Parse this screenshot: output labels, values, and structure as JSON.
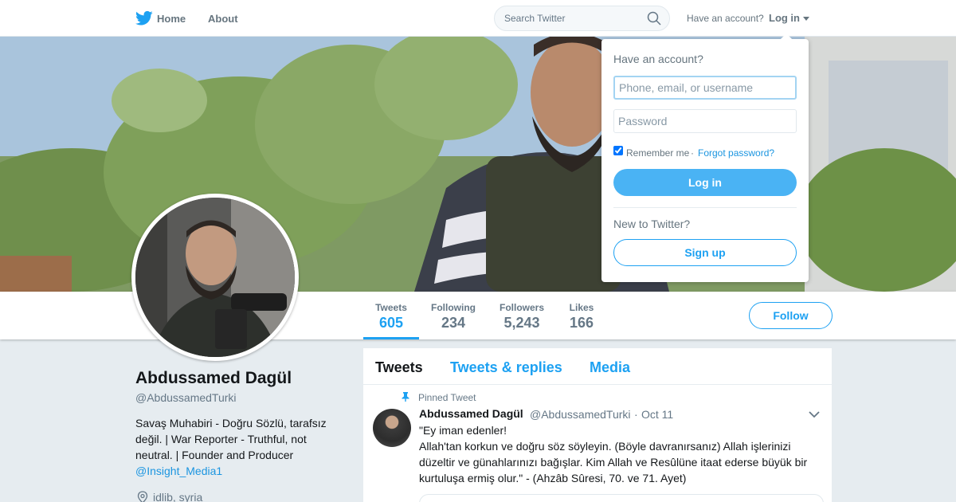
{
  "nav": {
    "home_label": "Home",
    "about_label": "About",
    "search_placeholder": "Search Twitter",
    "have_account_label": "Have an account?",
    "login_label": "Log in",
    "icons": [
      "twitter-bird-icon",
      "search-icon",
      "caret-down-icon"
    ]
  },
  "profile": {
    "name": "Abdussamed Dagül",
    "handle": "@AbdussamedTurki",
    "bio": "Savaş Muhabiri - Doğru Sözlü, tarafsız değil. | War Reporter - Truthful, not neutral. | Founder and Producer ",
    "bio_link": "@Insight_Media1",
    "location": "idlib, syria"
  },
  "stats": [
    {
      "label": "Tweets",
      "value": "605",
      "active": true
    },
    {
      "label": "Following",
      "value": "234",
      "active": false
    },
    {
      "label": "Followers",
      "value": "5,243",
      "active": false
    },
    {
      "label": "Likes",
      "value": "166",
      "active": false
    }
  ],
  "follow_label": "Follow",
  "timeline": {
    "tabs": [
      "Tweets",
      "Tweets & replies",
      "Media"
    ],
    "active_tab": "Tweets",
    "pinned_label": "Pinned Tweet",
    "tweet": {
      "name": "Abdussamed Dagül",
      "handle": "@AbdussamedTurki",
      "separator": "·",
      "date": "Oct 11",
      "text": "\"Ey iman edenler!\nAllah'tan korkun ve doğru söz söyleyin. (Böyle davranırsanız) Allah işlerinizi düzeltir ve günahlarınızı bağışlar. Kim Allah ve Resûlüne itaat ederse büyük bir kurtuluşa ermiş olur.\" - (Ahzâb Sûresi, 70. ve 71. Ayet)"
    }
  },
  "login_dropdown": {
    "title": "Have an account?",
    "username_placeholder": "Phone, email, or username",
    "password_placeholder": "Password",
    "remember_label": "Remember me",
    "separator": "·",
    "forgot_label": "Forgot password?",
    "login_button": "Log in",
    "new_label": "New to Twitter?",
    "signup_button": "Sign up"
  },
  "colors": {
    "accent": "#1da1f2",
    "login_button": "#4ab3f4",
    "background": "#e6ecf0"
  }
}
